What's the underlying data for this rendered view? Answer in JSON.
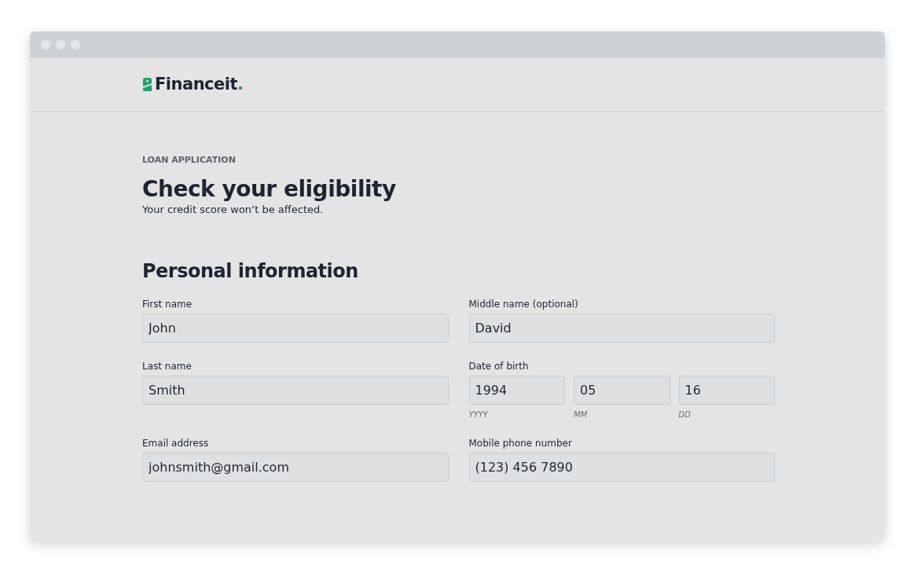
{
  "logo": {
    "text": "Financeit."
  },
  "eyebrow": "LOAN APPLICATION",
  "title": "Check your eligibility",
  "subtitle": "Your credit score won’t be affected.",
  "section": "Personal information",
  "fields": [
    {
      "kind": "text",
      "label": "First name",
      "value": "John"
    },
    {
      "kind": "text",
      "label": "Middle name (optional)",
      "value": "David"
    },
    {
      "kind": "text",
      "label": "Last name",
      "value": "Smith"
    },
    {
      "kind": "date",
      "label": "Date of birth",
      "parts": [
        {
          "value": "1994",
          "hint": "YYYY"
        },
        {
          "value": "05",
          "hint": "MM"
        },
        {
          "value": "16",
          "hint": "DD"
        }
      ]
    },
    {
      "kind": "text",
      "label": "Email address",
      "value": "johnsmith@gmail.com"
    },
    {
      "kind": "text",
      "label": "Mobile phone number",
      "value": "(123) 456 7890"
    }
  ]
}
